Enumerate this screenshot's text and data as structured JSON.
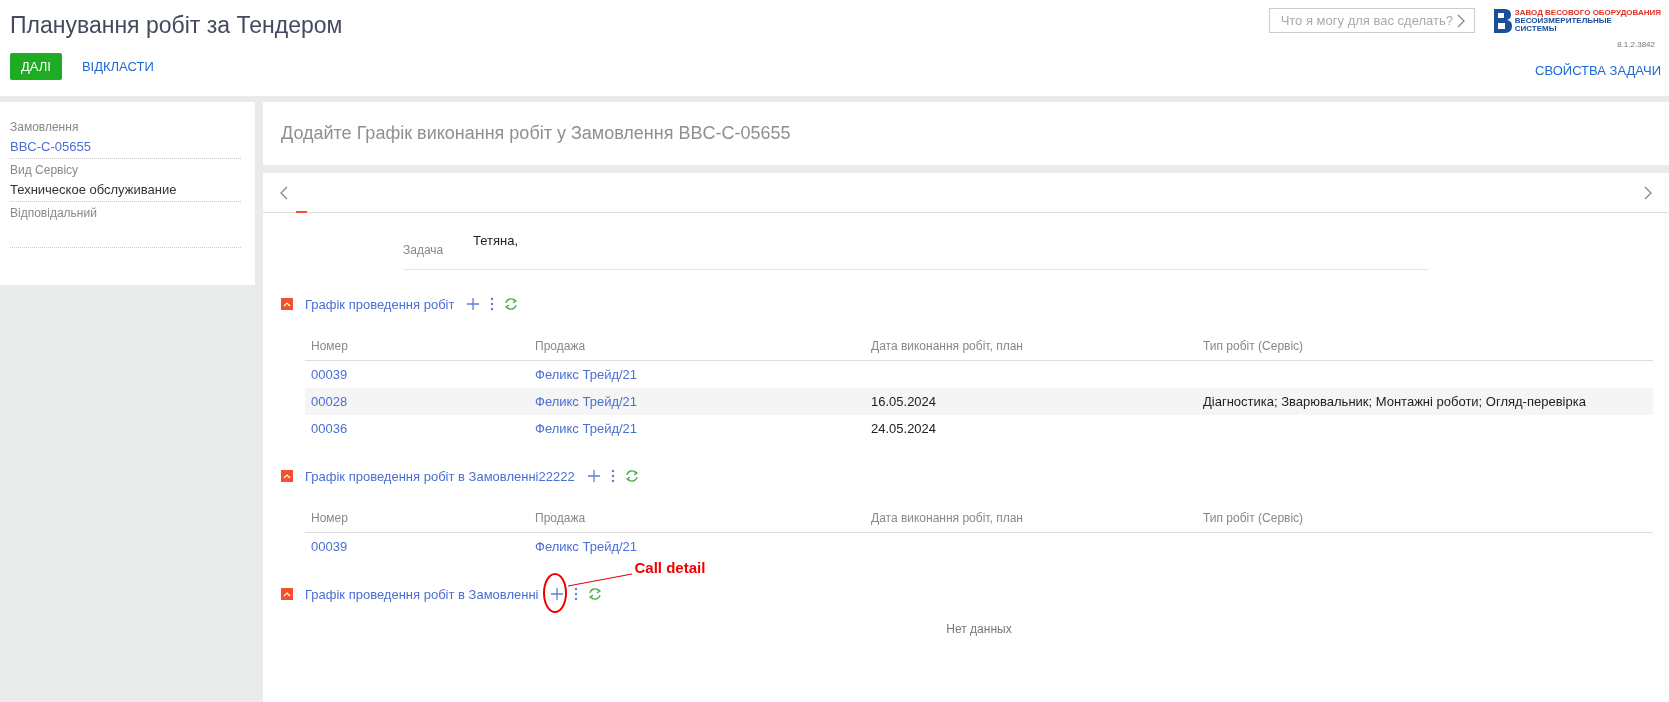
{
  "page": {
    "title": "Планування робіт за Тендером",
    "version": "8.1.2.3842"
  },
  "actions": [
    {
      "kind": "primary",
      "label": "ДАЛІ"
    },
    {
      "kind": "link",
      "label": "ВІДКЛАСТИ"
    }
  ],
  "search": {
    "placeholder": "Что я могу для вас сделать?"
  },
  "logo": {
    "line_1": "ЗАВОД ВЕСОВОГО ОБОРУДОВАНИЯ",
    "line_2": "ВЕСОИЗМЕРИТЕЛЬНЫЕ",
    "line_3": "СИСТЕМЫ"
  },
  "task_properties": "СВОЙСТВА ЗАДАЧИ",
  "sidebar": {
    "fields": [
      {
        "label": "Замовлення",
        "value": "BBC-C-05655",
        "kind": "link"
      },
      {
        "label": "Вид Сервісу",
        "value": "Техническое обслуживание",
        "kind": "text"
      },
      {
        "label": "Відповідальний"
      }
    ]
  },
  "header_card": {
    "title": "Додайте Графік виконання робіт у Замовлення BBC-C-05655"
  },
  "task_field": {
    "label": "Задача",
    "value": "Тетяна,"
  },
  "sections": [
    {
      "title": "Графік проведення робіт",
      "expanded": true,
      "columns": [
        "Номер",
        "Продажа",
        "Дата виконання робіт, план",
        "Тип робіт (Сервіс)"
      ],
      "rows": [
        {
          "selected": false,
          "cells": [
            "00039",
            "Феликс Трейд/21"
          ]
        },
        {
          "selected": true,
          "cells": [
            "00028",
            "Феликс Трейд/21",
            "16.05.2024",
            "Діагностика; Зварювальник; Монтажні роботи; Огляд-перевірка"
          ]
        },
        {
          "selected": false,
          "cells": [
            "00036",
            "Феликс Трейд/21",
            "24.05.2024"
          ]
        }
      ]
    },
    {
      "title": "Графік проведення робіт в Замовленні22222",
      "expanded": true,
      "columns": [
        "Номер",
        "Продажа",
        "Дата виконання робіт, план",
        "Тип робіт (Сервіс)"
      ],
      "rows": [
        {
          "selected": false,
          "cells": [
            "00039",
            "Феликс Трейд/21"
          ]
        }
      ]
    },
    {
      "title": "Графік проведення робіт в Замовленні",
      "expanded": true,
      "empty_text": "Нет данных",
      "annotation": "Call detail"
    }
  ]
}
